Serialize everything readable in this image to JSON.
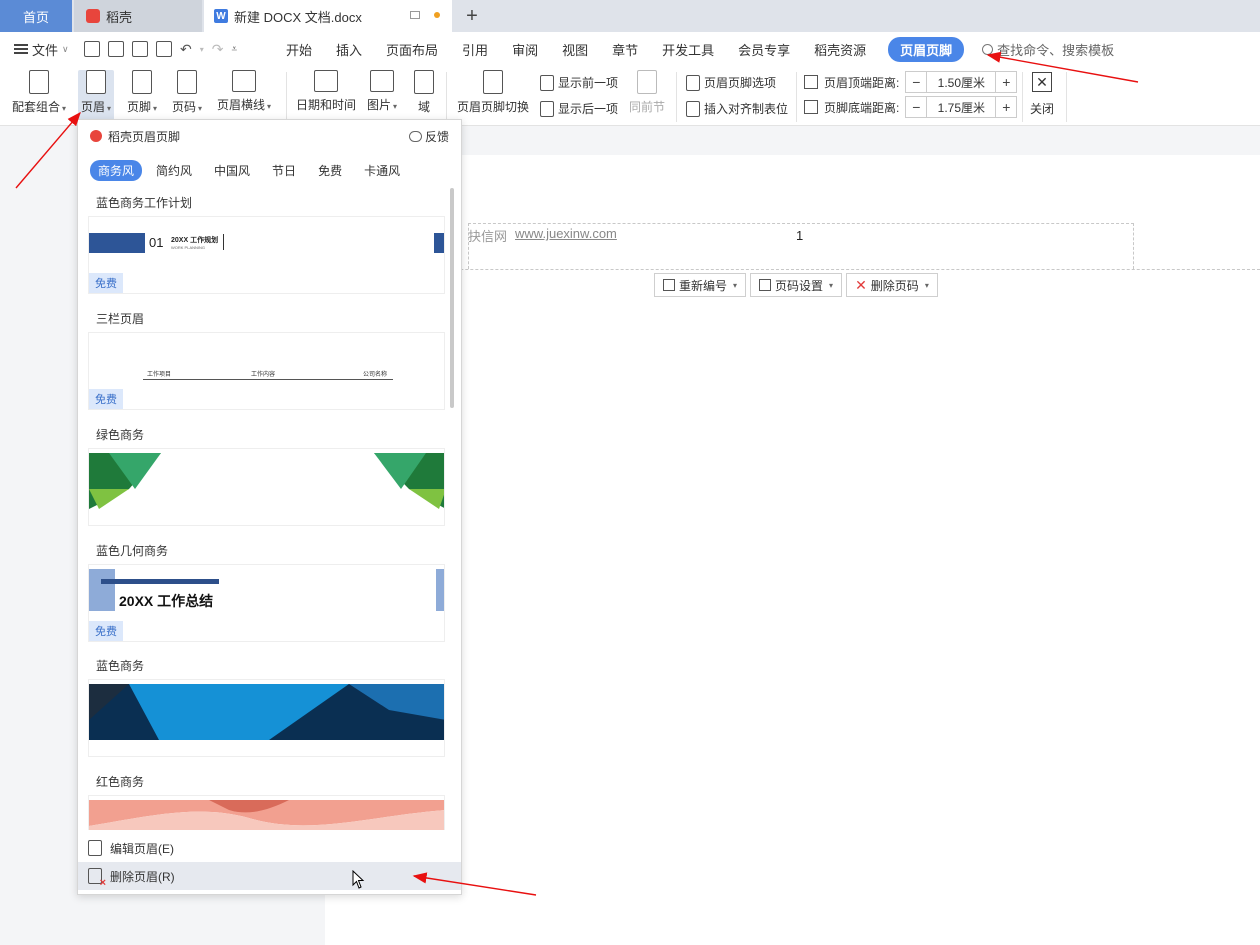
{
  "titlebar": {
    "home_tab": "首页",
    "daoke_tab": "稻壳",
    "doc_tab": "新建 DOCX 文档.docx",
    "add_tab": "+"
  },
  "menubar": {
    "file": "文件",
    "items": [
      "开始",
      "插入",
      "页面布局",
      "引用",
      "审阅",
      "视图",
      "章节",
      "开发工具",
      "会员专享",
      "稻壳资源"
    ],
    "active": "页眉页脚",
    "search_placeholder": "查找命令、搜索模板"
  },
  "ribbon": {
    "combo": "配套组合",
    "header": "页眉",
    "footer": "页脚",
    "page_number": "页码",
    "header_line": "页眉横线",
    "date_time": "日期和时间",
    "picture": "图片",
    "field": "域",
    "switch": "页眉页脚切换",
    "show_prev": "显示前一项",
    "show_next": "显示后一项",
    "same_prev": "同前节",
    "options": "页眉页脚选项",
    "insert_align": "插入对齐制表位",
    "top_dist_label": "页眉顶端距离:",
    "top_dist_value": "1.50厘米",
    "bottom_dist_label": "页脚底端距离:",
    "bottom_dist_value": "1.75厘米",
    "minus": "−",
    "plus": "+",
    "close": "关闭"
  },
  "document": {
    "watermark_text": "抉信网",
    "watermark_url": "www.juexinw.com",
    "page_number": "1",
    "renumber": "重新编号",
    "page_setup": "页码设置",
    "delete_number": "删除页码"
  },
  "dropdown": {
    "title": "稻壳页眉页脚",
    "feedback": "反馈",
    "categories": [
      "商务风",
      "简约风",
      "中国风",
      "节日",
      "免费",
      "卡通风"
    ],
    "templates": [
      {
        "title": "蓝色商务工作计划",
        "badge": "免费",
        "thumb_text": "01",
        "thumb_sub": "20XX 工作规划",
        "thumb_en": "WORK PLANNING"
      },
      {
        "title": "三栏页眉",
        "badge": "免费",
        "col1": "工作项目",
        "col2": "工作内容",
        "col3": "公司名称"
      },
      {
        "title": "绿色商务",
        "badge": ""
      },
      {
        "title": "蓝色几何商务",
        "badge": "免费",
        "thumb_text": "20XX 工作总结"
      },
      {
        "title": "蓝色商务",
        "badge": ""
      },
      {
        "title": "红色商务",
        "badge": ""
      }
    ],
    "edit_header": "编辑页眉(E)",
    "delete_header": "删除页眉(R)"
  },
  "colors": {
    "accent": "#4a86e8",
    "home_tab": "#5b8bd6",
    "arrow": "#e81010"
  }
}
